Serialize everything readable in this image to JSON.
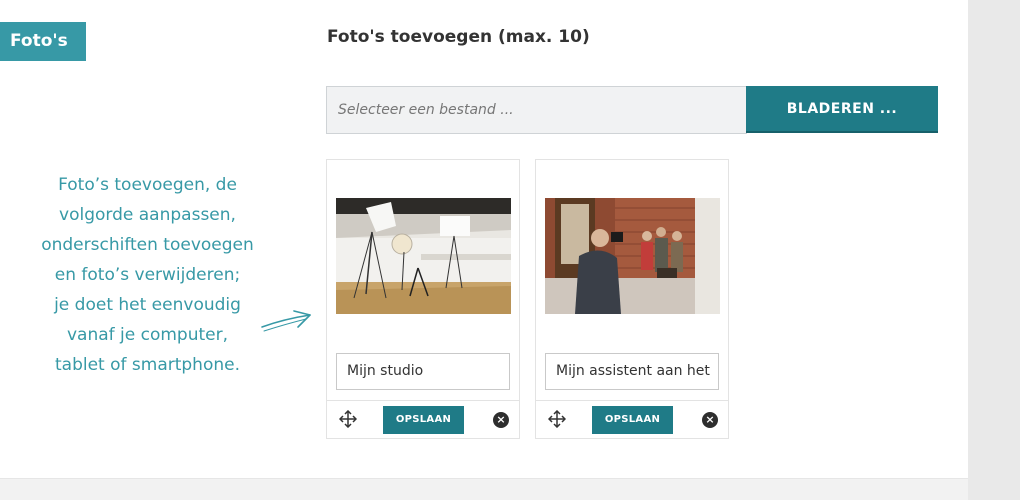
{
  "section": {
    "tag_label": "Foto's"
  },
  "upload": {
    "heading": "Foto's toevoegen (max. 10)",
    "file_placeholder": "Selecteer een bestand ...",
    "browse_label": "BLADEREN ..."
  },
  "help": {
    "lines": [
      "Foto’s toevoegen, de",
      "volgorde aanpassen,",
      "onderschiften toevoegen",
      "en foto’s verwijderen;",
      "je doet het eenvoudig",
      "vanaf je computer,",
      "tablet of smartphone."
    ]
  },
  "photos": [
    {
      "caption": "Mijn studio",
      "save_label": "OPSLAAN",
      "move_icon": "move-arrows-icon",
      "remove_icon": "close-circle-icon"
    },
    {
      "caption": "Mijn assistent aan het",
      "save_label": "OPSLAAN",
      "move_icon": "move-arrows-icon",
      "remove_icon": "close-circle-icon"
    }
  ],
  "colors": {
    "accent": "#3799a6",
    "button": "#1f7b87"
  }
}
